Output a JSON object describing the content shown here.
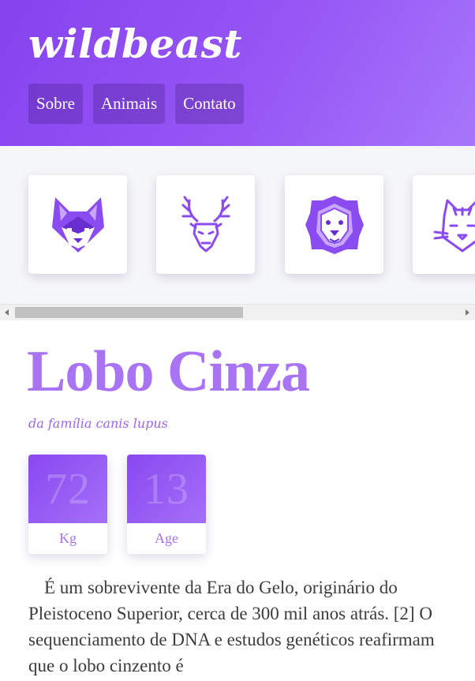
{
  "header": {
    "brand": "wildbeast",
    "nav": [
      "Sobre",
      "Animais",
      "Contato"
    ],
    "colors": {
      "gradient_start": "#8643ee",
      "gradient_end": "#a776fb"
    }
  },
  "carousel": {
    "cards": [
      {
        "icon": "wolf-icon"
      },
      {
        "icon": "deer-icon"
      },
      {
        "icon": "lion-icon"
      },
      {
        "icon": "cat-icon"
      }
    ],
    "scroll_position": 0
  },
  "animal": {
    "name": "Lobo Cinza",
    "family": "da família canis lupus",
    "stats": [
      {
        "value": "72",
        "label": "Kg"
      },
      {
        "value": "13",
        "label": "Age"
      }
    ],
    "description": "É um sobrevivente da Era do Gelo, originário do Pleistoceno Superior, cerca de 300 mil anos atrás. [2] O sequenciamento de DNA e estudos genéticos reafirmam que o lobo cinzento é"
  },
  "colors": {
    "accent": "#9a5cf4",
    "title": "#a874f4",
    "text": "#3c3c3c"
  }
}
